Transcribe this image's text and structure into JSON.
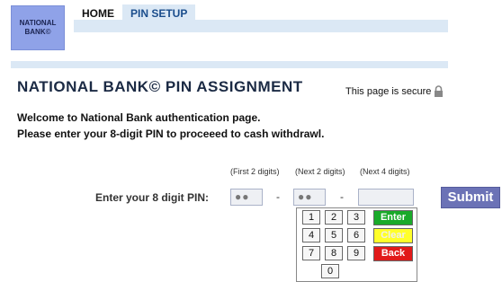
{
  "logo": {
    "text": "NATIONAL\nBANK©"
  },
  "tabs": [
    {
      "label": "HOME"
    },
    {
      "label": "PIN SETUP"
    }
  ],
  "page": {
    "title": "NATIONAL BANK© PIN ASSIGNMENT",
    "secure_text": "This page is secure"
  },
  "welcome": {
    "line1": "Welcome to National Bank authentication page.",
    "line2": "Please enter your 8-digit PIN to proceeed to cash withdrawl."
  },
  "pin": {
    "label": "Enter your 8 digit PIN:",
    "hint_first": "(First 2 digits)",
    "hint_next2": "(Next 2 digits)",
    "hint_next4": "(Next 4 digits)",
    "field1_value": "●●",
    "field2_value": "●●",
    "field3_value": "",
    "separator": "-"
  },
  "keypad": {
    "rows": [
      [
        "1",
        "2",
        "3"
      ],
      [
        "4",
        "5",
        "6"
      ],
      [
        "7",
        "8",
        "9"
      ]
    ],
    "zero": "0",
    "enter": "Enter",
    "clear": "Clear",
    "back": "Back"
  },
  "submit": {
    "label": "Submit"
  },
  "colors": {
    "accent": "#1a4d8c",
    "submit": "#6b72b6",
    "enter": "#1aaa2a",
    "clear": "#ffff2a",
    "back": "#e11a1a"
  },
  "icons": {
    "secure": "lock-icon"
  }
}
